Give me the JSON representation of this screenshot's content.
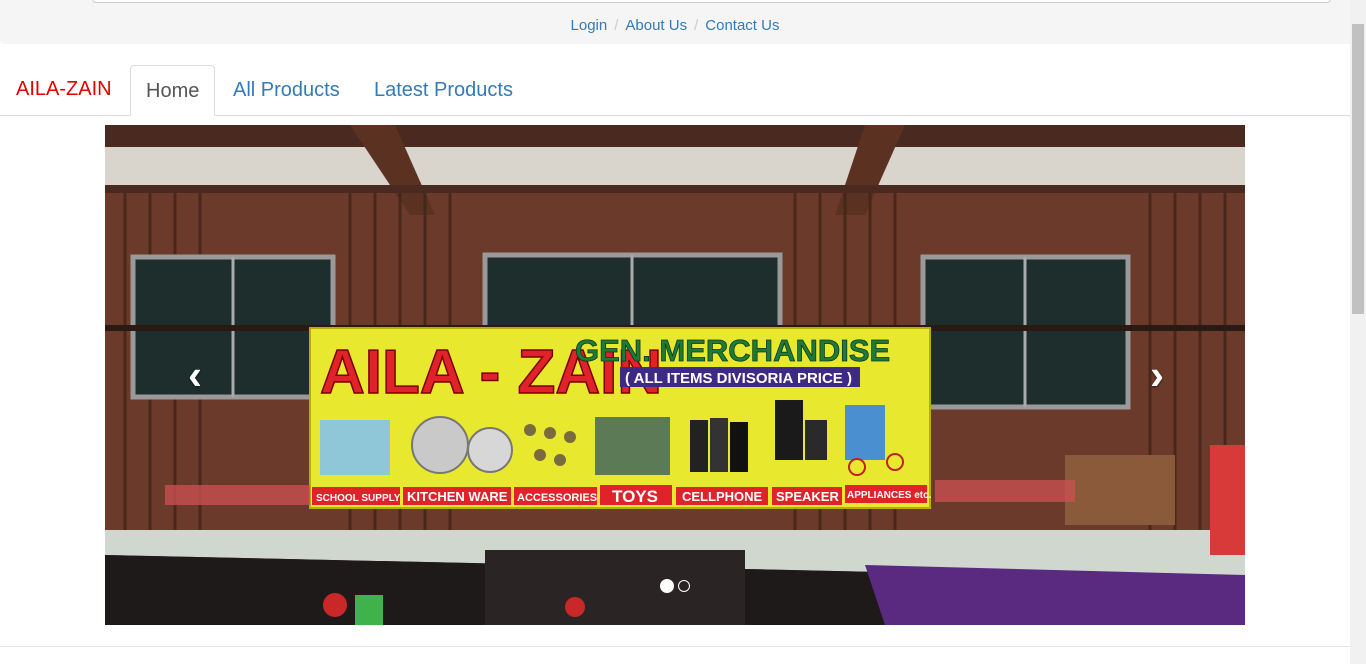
{
  "top_links": {
    "login": "Login",
    "about": "About Us",
    "contact": "Contact Us",
    "separator": "/"
  },
  "navbar": {
    "brand": "AILA-ZAIN",
    "tabs": [
      {
        "label": "Home",
        "active": true
      },
      {
        "label": "All Products",
        "active": false
      },
      {
        "label": "Latest Products",
        "active": false
      }
    ]
  },
  "carousel": {
    "prev_glyph": "‹",
    "next_glyph": "›",
    "slide_count": 2,
    "active_slide": 1,
    "sign": {
      "name": "AILA - ZAIN",
      "title": "GEN. MERCHANDISE",
      "subtitle": "( ALL ITEMS DIVISORIA PRICE )",
      "categories": [
        "SCHOOL SUPPLY",
        "KITCHEN WARE",
        "ACCESSORIES",
        "TOYS",
        "CELLPHONE",
        "SPEAKER",
        "APPLIANCES etc."
      ]
    }
  },
  "colors": {
    "brand": "#e00000",
    "link": "#337ab7",
    "sign_yellow": "#e8e82e",
    "sign_red": "#e0232b",
    "sign_green": "#1f7a3a"
  }
}
